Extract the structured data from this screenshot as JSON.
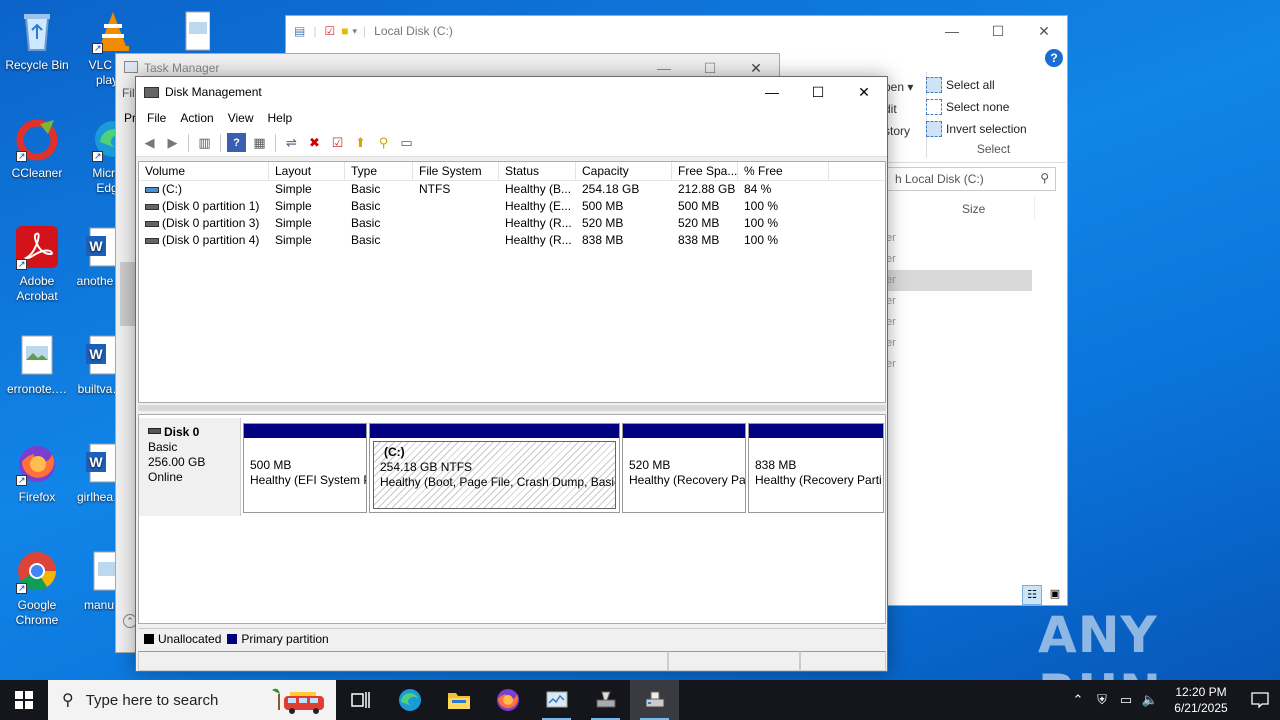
{
  "desktop": {
    "icons": [
      {
        "label": "Recycle Bin"
      },
      {
        "label": "VLC m… play…"
      },
      {
        "label": "CCleaner"
      },
      {
        "label": "Micro… Edg…"
      },
      {
        "label": "Adobe Acrobat"
      },
      {
        "label": "anothe…"
      },
      {
        "label": "erronote.…"
      },
      {
        "label": "builtva…"
      },
      {
        "label": "Firefox"
      },
      {
        "label": "girlhea…"
      },
      {
        "label": "Google Chrome"
      },
      {
        "label": "manu…"
      }
    ],
    "watermark": "ANY RUN"
  },
  "explorer": {
    "title": "Local Disk (C:)",
    "ribbon": {
      "select_all": "Select all",
      "select_none": "Select none",
      "invert_selection": "Invert selection",
      "group_label": "Select",
      "open_partial": "pen",
      "edit_partial": "dit",
      "history_partial": "story"
    },
    "search_placeholder": "h Local Disk (C:)",
    "column_size": "Size",
    "item_partial": "er"
  },
  "taskmgr": {
    "title": "Task Manager",
    "menu_partial": "Fil",
    "tab_partial": "Pr"
  },
  "disk_management": {
    "title": "Disk Management",
    "menu": [
      "File",
      "Action",
      "View",
      "Help"
    ],
    "columns": [
      "Volume",
      "Layout",
      "Type",
      "File System",
      "Status",
      "Capacity",
      "Free Spa...",
      "% Free"
    ],
    "volumes": [
      {
        "volume": "(C:)",
        "layout": "Simple",
        "type": "Basic",
        "fs": "NTFS",
        "status": "Healthy (B...",
        "capacity": "254.18 GB",
        "free": "212.88 GB",
        "pct": "84 %"
      },
      {
        "volume": "(Disk 0 partition 1)",
        "layout": "Simple",
        "type": "Basic",
        "fs": "",
        "status": "Healthy (E...",
        "capacity": "500 MB",
        "free": "500 MB",
        "pct": "100 %"
      },
      {
        "volume": "(Disk 0 partition 3)",
        "layout": "Simple",
        "type": "Basic",
        "fs": "",
        "status": "Healthy (R...",
        "capacity": "520 MB",
        "free": "520 MB",
        "pct": "100 %"
      },
      {
        "volume": "(Disk 0 partition 4)",
        "layout": "Simple",
        "type": "Basic",
        "fs": "",
        "status": "Healthy (R...",
        "capacity": "838 MB",
        "free": "838 MB",
        "pct": "100 %"
      }
    ],
    "disk": {
      "name": "Disk 0",
      "kind": "Basic",
      "size": "256.00 GB",
      "state": "Online",
      "partitions": [
        {
          "title": "",
          "size": "500 MB",
          "status": "Healthy (EFI System P"
        },
        {
          "title": "(C:)",
          "size": "254.18 GB NTFS",
          "status": "Healthy (Boot, Page File, Crash Dump, Basic D"
        },
        {
          "title": "",
          "size": "520 MB",
          "status": "Healthy (Recovery Pa"
        },
        {
          "title": "",
          "size": "838 MB",
          "status": "Healthy (Recovery Parti"
        }
      ]
    },
    "legend": {
      "unallocated": "Unallocated",
      "primary": "Primary partition"
    },
    "colors": {
      "primary_partition": "#000080",
      "unallocated": "#000000"
    }
  },
  "taskbar": {
    "search_placeholder": "Type here to search",
    "time": "12:20 PM",
    "date": "6/21/2025"
  }
}
